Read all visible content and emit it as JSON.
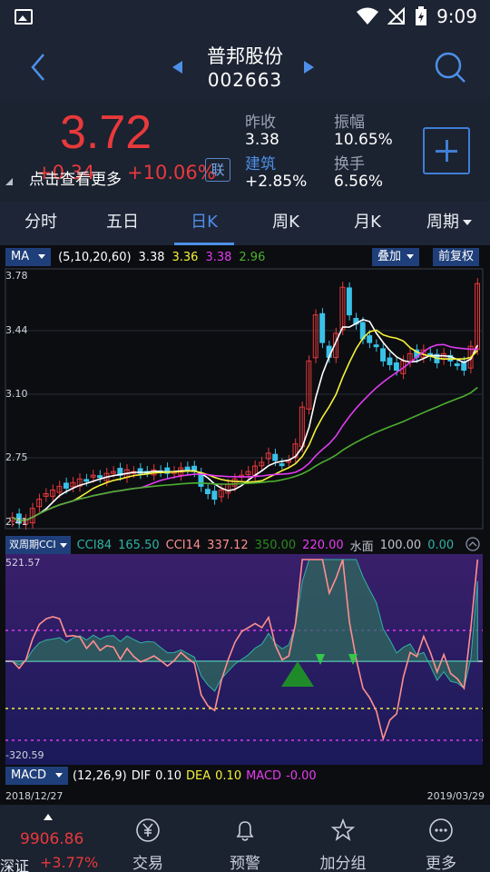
{
  "status_bar": {
    "time": "9:09"
  },
  "header": {
    "name": "普邦股份",
    "code": "002663"
  },
  "quote": {
    "price": "3.72",
    "change": "+0.34",
    "change_pct": "+10.06%",
    "hint": "点击查看更多",
    "badge": "联",
    "prev_close_label": "昨收",
    "prev_close": "3.38",
    "sector": "建筑",
    "sector_change": "+2.85%",
    "amplitude_label": "振幅",
    "amplitude": "10.65%",
    "turnover_label": "换手",
    "turnover": "6.56%"
  },
  "tabs": [
    {
      "label": "分时"
    },
    {
      "label": "五日"
    },
    {
      "label": "日K",
      "active": true
    },
    {
      "label": "周K"
    },
    {
      "label": "月K"
    },
    {
      "label": "周期"
    }
  ],
  "main_chart": {
    "indicator": "MA",
    "params": "(5,10,20,60)",
    "ma_values": [
      "3.38",
      "3.36",
      "3.38",
      "2.96"
    ],
    "ma_colors": [
      "#ffffff",
      "#f4f33a",
      "#e03bf0",
      "#4caf2f"
    ],
    "overlay_label": "叠加",
    "adjust_label": "前复权",
    "y_labels": [
      "3.78",
      "3.44",
      "3.10",
      "2.75",
      "2.41"
    ]
  },
  "cci_panel": {
    "indicator": "双周期CCI",
    "items": [
      {
        "text": "CCI84",
        "color": "#2fb3a3"
      },
      {
        "text": "165.50",
        "color": "#2fb3a3"
      },
      {
        "text": "CCI14",
        "color": "#ff8f8f"
      },
      {
        "text": "337.12",
        "color": "#ff8f8f"
      },
      {
        "text": "350.00",
        "color": "#2a8a1e"
      },
      {
        "text": "220.00",
        "color": "#e83cf0"
      },
      {
        "text": "水面",
        "color": "#bfc4cc"
      },
      {
        "text": "100.00",
        "color": "#bfc4cc"
      },
      {
        "text": "0.00",
        "color": "#2fb3a3"
      }
    ],
    "y_top": "521.57",
    "y_bottom": "-320.59"
  },
  "macd_panel": {
    "indicator": "MACD",
    "params": "(12,26,9)",
    "items": [
      {
        "text": "DIF",
        "color": "#ffffff"
      },
      {
        "text": "0.10",
        "color": "#ffffff"
      },
      {
        "text": "DEA",
        "color": "#f4f33a"
      },
      {
        "text": "0.10",
        "color": "#f4f33a"
      },
      {
        "text": "MACD",
        "color": "#e83cf0"
      },
      {
        "text": "-0.00",
        "color": "#e83cf0"
      }
    ]
  },
  "dates": {
    "start": "2018/12/27",
    "end": "2019/03/29"
  },
  "bottom_nav": {
    "index_value": "9906.86",
    "index_name": "深证",
    "index_pct": "+3.77%",
    "items": [
      {
        "label": "交易",
        "icon": "yen-circle-icon"
      },
      {
        "label": "预警",
        "icon": "bell-icon"
      },
      {
        "label": "加分组",
        "icon": "star-icon"
      },
      {
        "label": "更多",
        "icon": "more-dots-icon"
      }
    ]
  },
  "colors": {
    "up": "#e8393b",
    "down": "#39c2e8",
    "accent": "#4d8fe8"
  }
}
